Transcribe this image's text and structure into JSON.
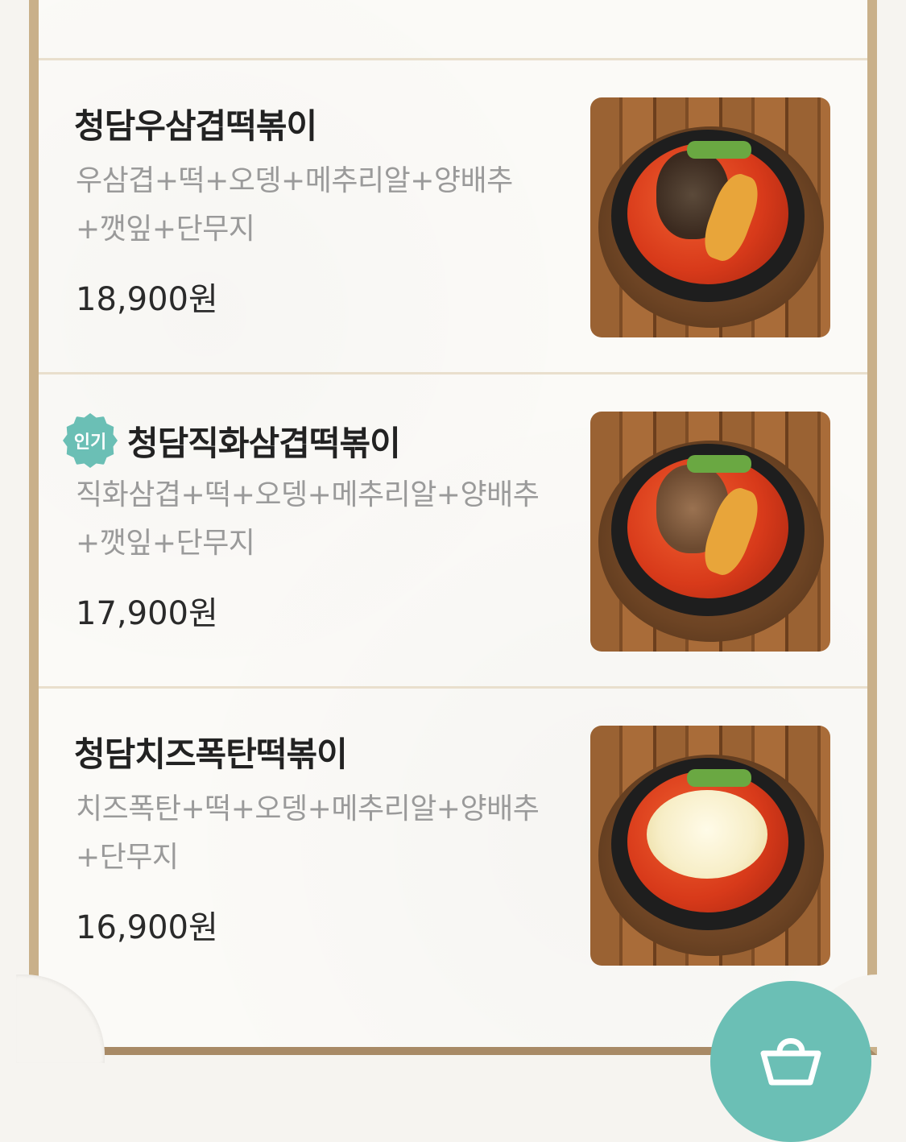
{
  "menu_items": [
    {
      "name": "청담우삼겹떡볶이",
      "badge": "",
      "description": "우삼겹+떡+오뎅+메추리알+양배추+깻잎+단무지",
      "price": "18,900원",
      "image_icon": "tteokbokki-beef-photo"
    },
    {
      "name": "청담직화삼겹떡볶이",
      "badge": "인기",
      "description": "직화삼겹+떡+오뎅+메추리알+양배추+깻잎+단무지",
      "price": "17,900원",
      "image_icon": "tteokbokki-pork-photo"
    },
    {
      "name": "청담치즈폭탄떡볶이",
      "badge": "",
      "description": "치즈폭탄+떡+오뎅+메추리알+양배추+단무지",
      "price": "16,900원",
      "image_icon": "tteokbokki-cheese-photo"
    }
  ],
  "cart_fab_icon": "basket-icon",
  "colors": {
    "accent": "#6bbfb5",
    "frame": "#c9b08a"
  }
}
